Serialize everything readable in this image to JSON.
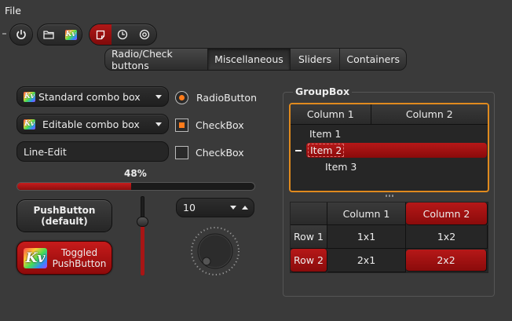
{
  "menu": {
    "file": "File"
  },
  "toolbar": {
    "group1": [
      {
        "icon": "power-icon"
      }
    ],
    "group2": [
      {
        "icon": "folder-icon"
      },
      {
        "icon": "kv-logo-icon",
        "glyph": "Kv"
      }
    ],
    "group3": [
      {
        "icon": "note-icon",
        "active": true
      },
      {
        "icon": "clock-icon"
      },
      {
        "icon": "target-icon"
      }
    ]
  },
  "tabs": [
    {
      "label": "Radio/Check buttons",
      "selected": false
    },
    {
      "label": "Miscellaneous",
      "selected": true
    },
    {
      "label": "Sliders",
      "selected": false
    },
    {
      "label": "Containers",
      "selected": false
    }
  ],
  "left": {
    "combo1": {
      "glyph": "Kv",
      "value": "Standard combo box"
    },
    "combo2": {
      "glyph": "Kv",
      "value": "Editable combo box"
    },
    "lineedit": {
      "value": "Line-Edit"
    },
    "radio": {
      "label": "RadioButton",
      "checked": true
    },
    "check1": {
      "label": "CheckBox",
      "checked": true
    },
    "check2": {
      "label": "CheckBox",
      "checked": false
    },
    "progress": {
      "label": "48%",
      "value": 48
    },
    "pushbutton": {
      "line1": "PushButton",
      "line2": "(default)"
    },
    "toggled": {
      "glyph": "Kv",
      "line1": "Toggled",
      "line2": "PushButton"
    },
    "slider": {
      "value": 70
    },
    "spinbox": {
      "value": "10"
    }
  },
  "groupbox": {
    "title": "GroupBox",
    "tree": {
      "columns": [
        "Column 1",
        "Column 2"
      ],
      "items": [
        {
          "label": "Item 1",
          "level": 0,
          "selected": false
        },
        {
          "label": "Item 2",
          "level": 0,
          "selected": true,
          "expanded": true
        },
        {
          "label": "Item 3",
          "level": 1,
          "selected": false
        }
      ]
    },
    "table": {
      "columns": [
        "Column 1",
        "Column 2"
      ],
      "rows": [
        {
          "header": "Row 1",
          "cells": [
            "1x1",
            "1x2"
          ]
        },
        {
          "header": "Row 2",
          "cells": [
            "2x1",
            "2x2"
          ]
        }
      ]
    }
  },
  "colors": {
    "accent_red": "#a81515",
    "accent_orange": "#ff7b1a",
    "focus_orange": "#e08a1e",
    "background": "#3a3a3a"
  }
}
